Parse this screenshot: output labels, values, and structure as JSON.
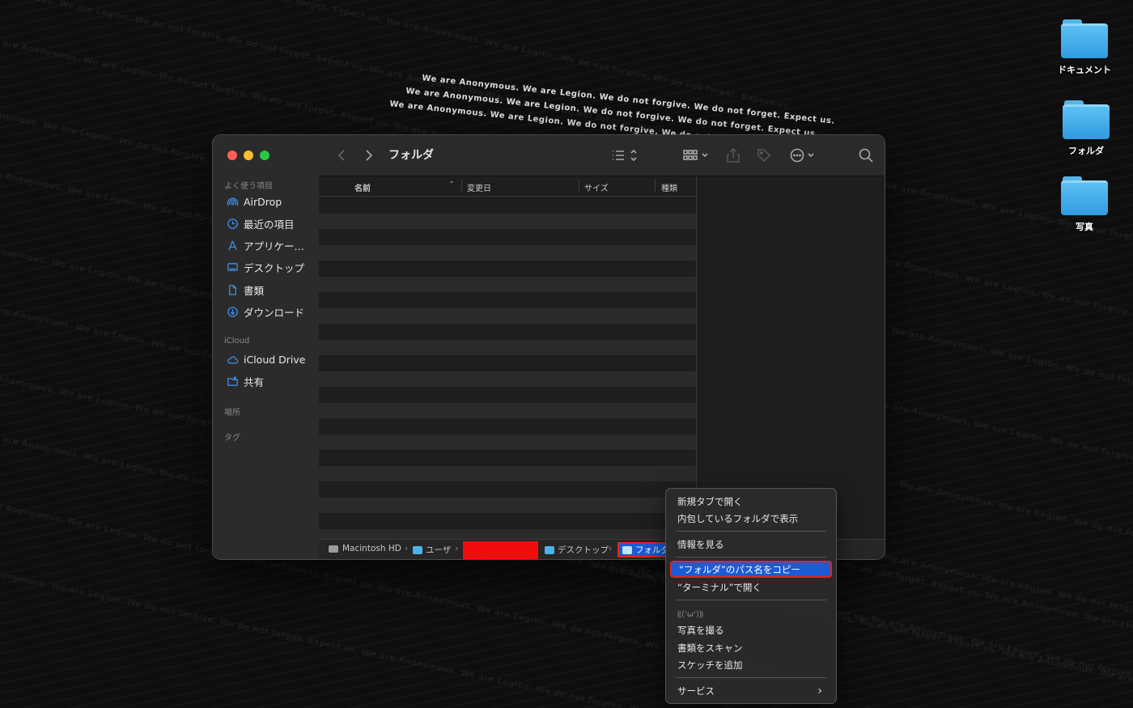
{
  "desktop": {
    "wallpaper_text": "We are Anonymous. We are Legion. We do not forgive. We do not forget. Expect us.",
    "icons": [
      {
        "label": "ドキュメント",
        "icon": "folder-icon"
      },
      {
        "label": "フォルダ",
        "icon": "folder-icon"
      },
      {
        "label": "写真",
        "icon": "folder-icon"
      }
    ]
  },
  "finder": {
    "title": "フォルダ",
    "sidebar": {
      "favorites_header": "よく使う項目",
      "favorites": [
        {
          "label": "AirDrop",
          "icon": "airdrop-icon"
        },
        {
          "label": "最近の項目",
          "icon": "clock-icon"
        },
        {
          "label": "アプリケー…",
          "icon": "applications-icon"
        },
        {
          "label": "デスクトップ",
          "icon": "desktop-icon"
        },
        {
          "label": "書類",
          "icon": "document-icon"
        },
        {
          "label": "ダウンロード",
          "icon": "download-icon"
        }
      ],
      "icloud_header": "iCloud",
      "icloud": [
        {
          "label": "iCloud Drive",
          "icon": "cloud-icon"
        },
        {
          "label": "共有",
          "icon": "shared-folder-icon"
        }
      ],
      "locations_header": "場所",
      "tags_header": "タグ"
    },
    "columns": {
      "name": "名前",
      "modified": "変更日",
      "size": "サイズ",
      "kind": "種類"
    },
    "pathbar": {
      "disk": "Macintosh HD",
      "users": "ユーザ",
      "desktop": "デスクトップ",
      "current": "フォルダ"
    }
  },
  "context_menu": {
    "items": [
      "新規タブで開く",
      "内包しているフォルダで表示",
      "情報を見る",
      "“フォルダ”のパス名をコピー",
      "“ターミナル”で開く",
      "⸨('ω')⸩",
      "写真を撮る",
      "書類をスキャン",
      "スケッチを追加",
      "サービス"
    ],
    "highlighted_index": 3,
    "submenu_arrow": "›"
  },
  "colors": {
    "accent_selection": "#1c5bd6",
    "annotation_red": "#e0261c",
    "folder_blue": "#3fa9ec"
  }
}
